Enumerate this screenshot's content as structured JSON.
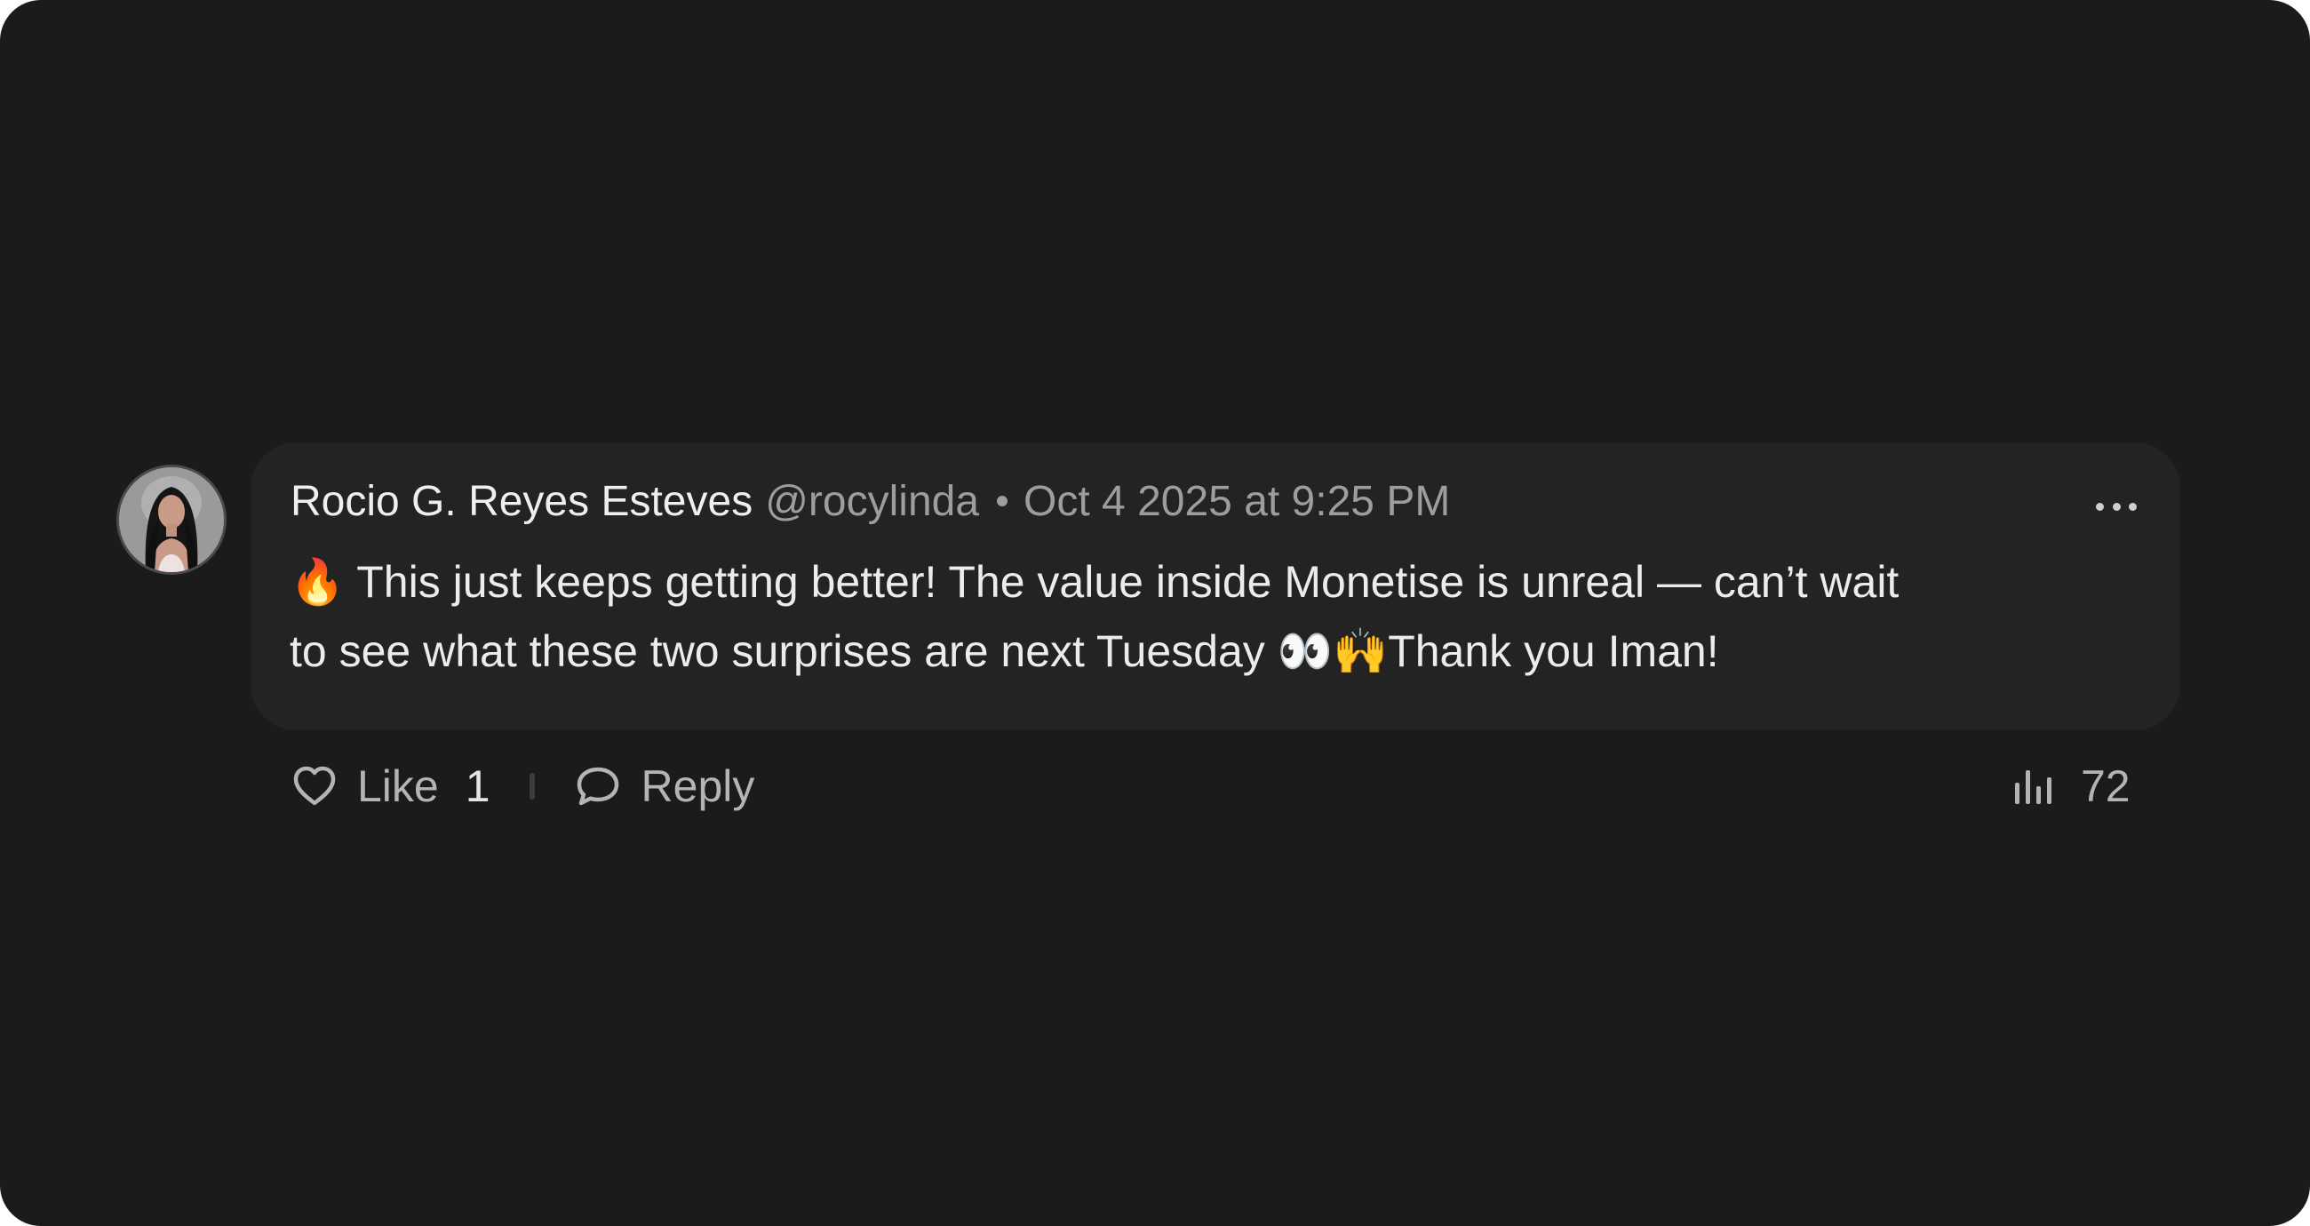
{
  "comment": {
    "author_name": "Rocio G. Reyes Esteves",
    "handle": "@rocylinda",
    "timestamp": "Oct 4 2025 at 9:25 PM",
    "body_lines": [
      "🔥 This just keeps getting better! The value inside Monetise is unreal — can’t wait",
      "to see what these two surprises are next Tuesday 👀🙌Thank you Iman!"
    ]
  },
  "actions": {
    "like_label": "Like",
    "like_count": "1",
    "reply_label": "Reply",
    "views_count": "72"
  },
  "icons": {
    "avatar": "profile-photo",
    "more": "ellipsis-icon",
    "like": "heart-outline-icon",
    "reply": "speech-bubble-icon",
    "views": "bar-chart-icon"
  },
  "colors": {
    "background": "#1b1b1b",
    "bubble": "#232323",
    "author": "#efefef",
    "muted": "#9d9d9d"
  }
}
